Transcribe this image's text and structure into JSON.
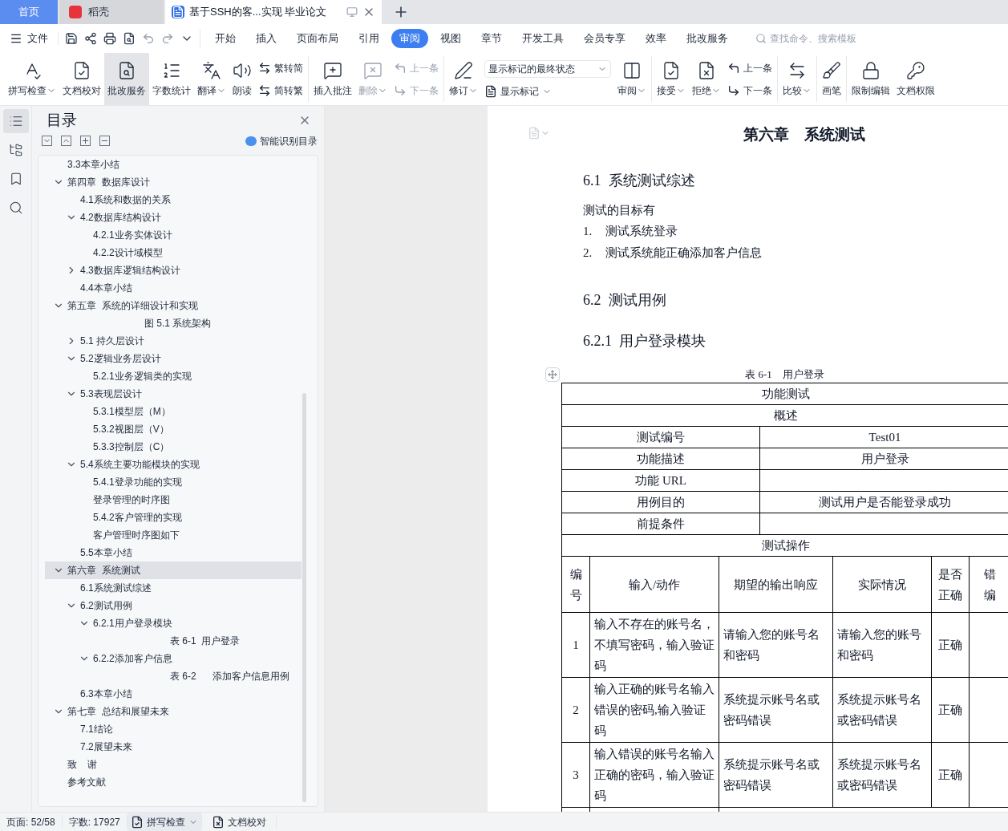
{
  "tabs": [
    {
      "label": "首页",
      "kind": "home",
      "selected": false
    },
    {
      "label": "稻壳",
      "kind": "docer",
      "selected": false
    },
    {
      "label": "基于SSH的客...实现 毕业论文",
      "kind": "doc",
      "selected": true
    }
  ],
  "menu": {
    "file": "文件",
    "tabs": [
      {
        "label": "开始",
        "selected": false
      },
      {
        "label": "插入",
        "selected": false
      },
      {
        "label": "页面布局",
        "selected": false
      },
      {
        "label": "引用",
        "selected": false
      },
      {
        "label": "审阅",
        "selected": true
      },
      {
        "label": "视图",
        "selected": false
      },
      {
        "label": "章节",
        "selected": false
      },
      {
        "label": "开发工具",
        "selected": false
      },
      {
        "label": "会员专享",
        "selected": false
      },
      {
        "label": "效率",
        "selected": false
      },
      {
        "label": "批改服务",
        "selected": false
      }
    ],
    "search": {
      "placeholder": "查找命令、搜索模板"
    }
  },
  "ribbon": [
    {
      "kind": "large",
      "label": "拼写检查",
      "dropdown": true,
      "highlighted": false,
      "disabled": false
    },
    {
      "kind": "large",
      "label": "文档校对",
      "dropdown": false,
      "highlighted": false,
      "disabled": false
    },
    {
      "kind": "large",
      "label": "批改服务",
      "dropdown": false,
      "highlighted": true,
      "disabled": false
    },
    {
      "kind": "large",
      "label": "字数统计",
      "dropdown": false,
      "highlighted": false,
      "disabled": false
    },
    {
      "kind": "large",
      "label": "翻译",
      "dropdown": true,
      "highlighted": false,
      "disabled": false
    },
    {
      "kind": "large",
      "label": "朗读",
      "dropdown": false,
      "highlighted": false,
      "disabled": false
    },
    {
      "kind": "pair",
      "items": [
        {
          "label": "繁转简",
          "disabled": false
        },
        {
          "label": "简转繁",
          "disabled": false
        }
      ]
    },
    {
      "kind": "divider"
    },
    {
      "kind": "large",
      "label": "插入批注",
      "dropdown": false,
      "highlighted": false,
      "disabled": false
    },
    {
      "kind": "large",
      "label": "删除",
      "dropdown": true,
      "highlighted": false,
      "disabled": true
    },
    {
      "kind": "pair",
      "items": [
        {
          "label": "上一条",
          "disabled": true
        },
        {
          "label": "下一条",
          "disabled": true
        }
      ]
    },
    {
      "kind": "divider"
    },
    {
      "kind": "large",
      "label": "修订",
      "dropdown": true,
      "highlighted": false,
      "disabled": false
    },
    {
      "kind": "select",
      "value": "显示标记的最终状态",
      "below": "显示标记"
    },
    {
      "kind": "large",
      "label": "审阅",
      "dropdown": true,
      "highlighted": false,
      "disabled": false
    },
    {
      "kind": "divider"
    },
    {
      "kind": "large",
      "label": "接受",
      "dropdown": true,
      "highlighted": false,
      "disabled": false
    },
    {
      "kind": "large",
      "label": "拒绝",
      "dropdown": true,
      "highlighted": false,
      "disabled": false
    },
    {
      "kind": "pair",
      "items": [
        {
          "label": "上一条",
          "disabled": false
        },
        {
          "label": "下一条",
          "disabled": false
        }
      ]
    },
    {
      "kind": "divider"
    },
    {
      "kind": "large",
      "label": "比较",
      "dropdown": true,
      "highlighted": false,
      "disabled": false
    },
    {
      "kind": "divider"
    },
    {
      "kind": "large",
      "label": "画笔",
      "dropdown": false,
      "highlighted": false,
      "disabled": false
    },
    {
      "kind": "divider"
    },
    {
      "kind": "large",
      "label": "限制编辑",
      "dropdown": false,
      "highlighted": false,
      "disabled": false
    },
    {
      "kind": "large",
      "label": "文档权限",
      "dropdown": false,
      "highlighted": false,
      "disabled": false
    }
  ],
  "rail": [
    {
      "selected": true
    },
    {
      "selected": false
    },
    {
      "selected": false
    },
    {
      "selected": false
    }
  ],
  "toc_panel": {
    "title": "目录",
    "smart_button": "智能识别目录"
  },
  "toc": [
    {
      "label": "3.3本章小结",
      "selected": false
    },
    {
      "label": "第四章  数据库设计",
      "selected": false,
      "expanded": true,
      "children": [
        {
          "label": "4.1系统和数据的关系",
          "selected": false
        },
        {
          "label": "4.2数据库结构设计",
          "selected": false,
          "expanded": true,
          "children": [
            {
              "label": "4.2.1业务实体设计",
              "selected": false
            },
            {
              "label": "4.2.2设计域模型",
              "selected": false
            }
          ]
        },
        {
          "label": "4.3数据库逻辑结构设计",
          "selected": false,
          "expanded": false
        },
        {
          "label": "4.4本章小结",
          "selected": false
        }
      ]
    },
    {
      "label": "第五章  系统的详细设计和实现",
      "selected": false,
      "expanded": true,
      "children": [
        {
          "label": "图 5.1 系统架构",
          "kind": "caption",
          "selected": false
        },
        {
          "label": "5.1 持久层设计",
          "selected": false,
          "expanded": false
        },
        {
          "label": "5.2逻辑业务层设计",
          "selected": false,
          "expanded": true,
          "children": [
            {
              "label": "5.2.1业务逻辑类的实现",
              "selected": false
            }
          ]
        },
        {
          "label": "5.3表现层设计",
          "selected": false,
          "expanded": true,
          "children": [
            {
              "label": "5.3.1模型层（M）",
              "selected": false
            },
            {
              "label": "5.3.2视图层（V）",
              "selected": false
            },
            {
              "label": "5.3.3控制层（C）",
              "selected": false
            }
          ]
        },
        {
          "label": "5.4系统主要功能模块的实现",
          "selected": false,
          "expanded": true,
          "children": [
            {
              "label": "5.4.1登录功能的实现",
              "selected": false
            },
            {
              "label": "登录管理的时序图",
              "selected": false
            },
            {
              "label": "5.4.2客户管理的实现",
              "selected": false
            },
            {
              "label": "客户管理时序图如下",
              "selected": false
            }
          ]
        },
        {
          "label": "5.5本章小结",
          "selected": false
        }
      ]
    },
    {
      "label": "第六章  系统测试",
      "selected": true,
      "expanded": true,
      "children": [
        {
          "label": "6.1系统测试综述",
          "selected": false
        },
        {
          "label": "6.2测试用例",
          "selected": false,
          "expanded": true,
          "children": [
            {
              "label": "6.2.1用户登录模块",
              "selected": false,
              "expanded": true,
              "children": [
                {
                  "label": "表 6-1  用户登录",
                  "kind": "caption",
                  "selected": false
                }
              ]
            },
            {
              "label": "6.2.2添加客户信息",
              "selected": false,
              "expanded": true,
              "children": [
                {
                  "label": "表 6-2      添加客户信息用例",
                  "kind": "caption",
                  "selected": false
                }
              ]
            }
          ]
        },
        {
          "label": "6.3本章小结",
          "selected": false
        }
      ]
    },
    {
      "label": "第七章  总结和展望未来",
      "selected": false,
      "expanded": true,
      "children": [
        {
          "label": "7.1结论",
          "selected": false
        },
        {
          "label": "7.2展望未来",
          "selected": false
        }
      ]
    },
    {
      "label": "致    谢",
      "selected": false
    },
    {
      "label": "参考文献",
      "selected": false
    }
  ],
  "doc": {
    "chapter_title": "第六章　系统测试",
    "blocks": [
      {
        "kind": "h2",
        "text": "6.1  系统测试综述"
      },
      {
        "kind": "p",
        "text": "测试的目标有"
      },
      {
        "kind": "li",
        "marker": "1.",
        "text": "测试系统登录"
      },
      {
        "kind": "li",
        "marker": "2.",
        "text": "测试系统能正确添加客户信息"
      },
      {
        "kind": "h2",
        "text": "6.2  测试用例"
      },
      {
        "kind": "h3",
        "text": "6.2.1  用户登录模块"
      }
    ]
  },
  "table": {
    "caption": "表 6-1　用户登录",
    "title_rows": [
      "功能测试",
      "概述"
    ],
    "fields": [
      {
        "name": "测试编号",
        "value": "Test01"
      },
      {
        "name": "功能描述",
        "value": "用户登录"
      },
      {
        "name": "功能 URL"
      },
      {
        "name": "用例目的",
        "value": "测试用户是否能登录成功"
      },
      {
        "name": "前提条件"
      }
    ],
    "section": "测试操作",
    "columns": [
      "编号",
      "输入/动作",
      "期望的输出响应",
      "实际情况",
      "是否正确",
      "错编"
    ],
    "rows": [
      [
        "1",
        "输入不存在的账号名，不填写密码，输入验证码",
        "请输入您的账号名和密码",
        "请输入您的账号和密码",
        "正确"
      ],
      [
        "2",
        "输入正确的账号名输入错误的密码,输入验证码",
        "系统提示账号名或密码错误",
        "系统提示账号名或密码错误",
        "正确"
      ],
      [
        "3",
        "输入错误的账号名输入正确的密码，输入验证码",
        "系统提示账号名或密码错误",
        "系统提示账号名或密码错误",
        "正确"
      ]
    ]
  },
  "status": {
    "page": "页面: 52/58",
    "words": "字数: 17927",
    "spell": "拼写检查",
    "proof": "文档校对"
  }
}
